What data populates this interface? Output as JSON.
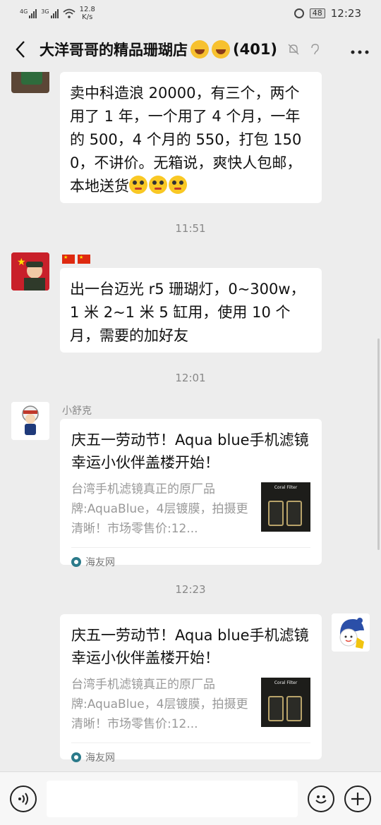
{
  "status_bar": {
    "network1": "4G",
    "network2": "3G",
    "speed_value": "12.8",
    "speed_unit": "K/s",
    "battery": "48",
    "time": "12:23"
  },
  "header": {
    "title": "大洋哥哥的精品珊瑚店",
    "member_count": "(401)"
  },
  "messages": {
    "m1": {
      "text": "卖中科造浪 20000，有三个，两个用了 1 年，一个用了 4 个月，一年的 500，4 个月的 550，打包 1500，不讲价。无箱说，爽快人包邮，本地送货"
    },
    "time1": "11:51",
    "m2": {
      "text": "出一台迈光 r5 珊瑚灯，0~300w，1 米 2~1 米 5 缸用，使用 10 个月，需要的加好友"
    },
    "time2": "12:01",
    "m3": {
      "sender": "小舒克",
      "link_title": "庆五一劳动节！Aqua blue手机滤镜幸运小伙伴盖楼开始！",
      "link_desc": "台湾手机滤镜真正的原厂品牌:AquaBlue，4层镀膜，拍摄更清晰！市场零售价:12...",
      "thumb_label": "Coral Filter",
      "source": "海友网"
    },
    "time3": "12:23",
    "m4": {
      "link_title": "庆五一劳动节！Aqua blue手机滤镜幸运小伙伴盖楼开始！",
      "link_desc": "台湾手机滤镜真正的原厂品牌:AquaBlue，4层镀膜，拍摄更清晰！市场零售价:12...",
      "thumb_label": "Coral Filter",
      "source": "海友网"
    }
  },
  "icons": {
    "back": "chevron-left-icon",
    "mute": "bell-off-icon",
    "earpiece": "ear-icon",
    "more": "more-dots-icon",
    "voice": "voice-icon",
    "emoji": "smiley-icon",
    "plus": "plus-icon"
  },
  "colors": {
    "background": "#ededed",
    "bubble": "#ffffff",
    "time_text": "#888888"
  }
}
